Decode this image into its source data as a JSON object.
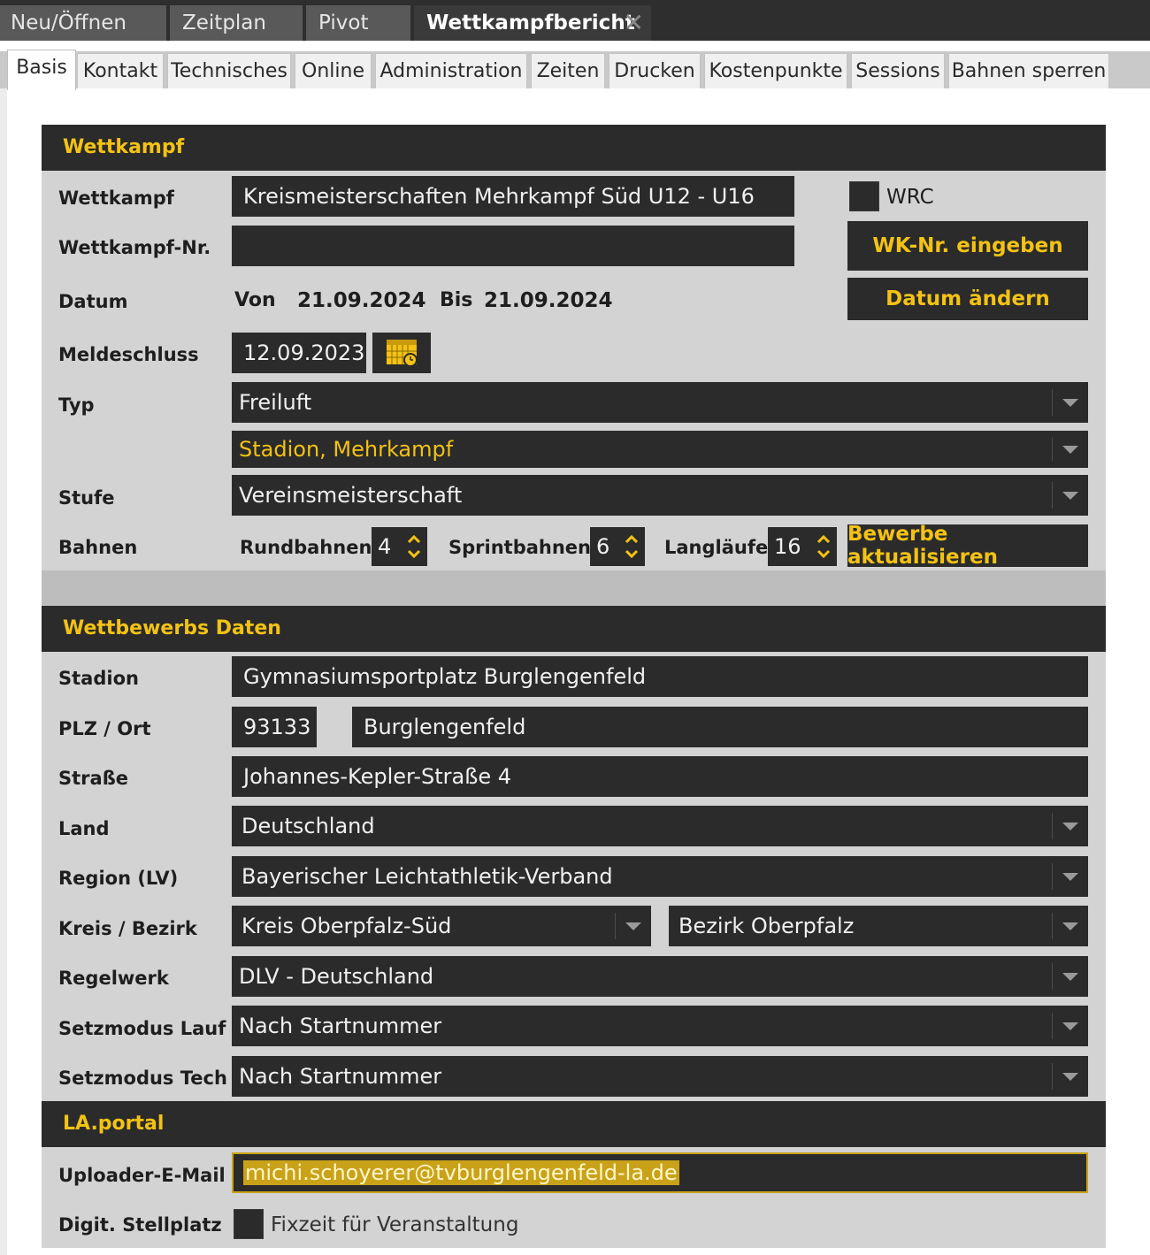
{
  "top_tabs": [
    {
      "label": "Neu/Öffnen"
    },
    {
      "label": "Zeitplan"
    },
    {
      "label": "Pivot"
    },
    {
      "label": "Wettkampfbericht"
    }
  ],
  "sub_tabs": [
    {
      "label": "Basis"
    },
    {
      "label": "Kontakt"
    },
    {
      "label": "Technisches"
    },
    {
      "label": "Online"
    },
    {
      "label": "Administration"
    },
    {
      "label": "Zeiten"
    },
    {
      "label": "Drucken"
    },
    {
      "label": "Kostenpunkte"
    },
    {
      "label": "Sessions"
    },
    {
      "label": "Bahnen sperren"
    }
  ],
  "wettkampf": {
    "header": "Wettkampf",
    "name_label": "Wettkampf",
    "name_value": "Kreismeisterschaften Mehrkampf Süd U12 - U16",
    "wrc_label": "WRC",
    "nr_label": "Wettkampf-Nr.",
    "nr_value": "",
    "wknr_button": "WK-Nr. eingeben",
    "datum_label": "Datum",
    "von_label": "Von",
    "von_value": "21.09.2024",
    "bis_label": "Bis",
    "bis_value": "21.09.2024",
    "datum_button": "Datum ändern",
    "meldeschluss_label": "Meldeschluss",
    "meldeschluss_value": "12.09.2023",
    "typ_label": "Typ",
    "typ_value": "Freiluft",
    "subtyp_value": "Stadion, Mehrkampf",
    "stufe_label": "Stufe",
    "stufe_value": "Vereinsmeisterschaft",
    "bahnen_label": "Bahnen",
    "rundbahnen_label": "Rundbahnen",
    "rundbahnen_value": "4",
    "sprintbahnen_label": "Sprintbahnen",
    "sprintbahnen_value": "6",
    "langlaeufe_label": "Langläufe",
    "langlaeufe_value": "16",
    "bewerbe_button": "Bewerbe aktualisieren"
  },
  "wettbewerb": {
    "header": "Wettbewerbs Daten",
    "stadion_label": "Stadion",
    "stadion_value": "Gymnasiumsportplatz Burglengenfeld",
    "plz_label": "PLZ / Ort",
    "plz_value": "93133",
    "ort_value": "Burglengenfeld",
    "strasse_label": "Straße",
    "strasse_value": "Johannes-Kepler-Straße 4",
    "land_label": "Land",
    "land_value": "Deutschland",
    "region_label": "Region (LV)",
    "region_value": "Bayerischer Leichtathletik-Verband",
    "kreis_label": "Kreis / Bezirk",
    "kreis_value": "Kreis Oberpfalz-Süd",
    "bezirk_value": "Bezirk Oberpfalz",
    "regelwerk_label": "Regelwerk",
    "regelwerk_value": "DLV - Deutschland",
    "setz_lauf_label": "Setzmodus Lauf",
    "setz_lauf_value": "Nach Startnummer",
    "setz_tech_label": "Setzmodus Tech",
    "setz_tech_value": "Nach Startnummer"
  },
  "laportal": {
    "header": "LA.portal",
    "email_label": "Uploader-E-Mail",
    "email_value": "michi.schoyerer@tvburglengenfeld-la.de",
    "stellplatz_label": "Digit. Stellplatz",
    "fixzeit_label": "Fixzeit für Veranstaltung"
  },
  "colors": {
    "accent": "#f3c215",
    "dark": "#2b2b2b",
    "panel": "#d3d3d3"
  }
}
